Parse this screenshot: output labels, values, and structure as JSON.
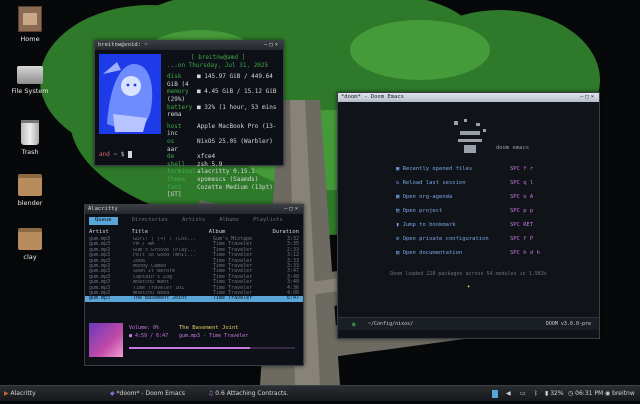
{
  "desktop": {
    "icons": [
      {
        "label": "Home"
      },
      {
        "label": "File System"
      },
      {
        "label": "Trash"
      },
      {
        "label": "blender"
      },
      {
        "label": "clay"
      }
    ]
  },
  "neofetch": {
    "title": "breitnw@void: ~",
    "header_user": "[ breitnw@amd ]",
    "header_date": "...on Thursday, Jul 31, 2025",
    "rows": [
      {
        "key": "disk",
        "value": "■ 145.97 GiB / 449.64 GiB (4"
      },
      {
        "key": "memory",
        "value": "■ 4.45 GiB / 15.12 GiB (29%)"
      },
      {
        "key": "battery",
        "value": "■ 32% (1 hour, 53 mins rema"
      },
      {
        "key": "host",
        "value": "Apple MacBook Pro (13-inc"
      },
      {
        "key": "os",
        "value": "NixOS 25.05 (Warbler) aar"
      },
      {
        "key": "de",
        "value": "xfce4"
      },
      {
        "key": "shell",
        "value": "zsh 5.9"
      },
      {
        "key": "terminal",
        "value": "alacritty 0.15.1"
      },
      {
        "key": "theme",
        "value": "xpomescs (Saamds)"
      },
      {
        "key": "font",
        "value": "Cozette Medium (13pt) [GT]"
      }
    ],
    "prompt_user": "and",
    "prompt_path": "~ $"
  },
  "ncmpcpp": {
    "title": "Alacritty",
    "tabs": [
      "Queue",
      "Directories",
      "Artists",
      "Albums",
      "Playlists"
    ],
    "columns": [
      "Artist",
      "Title",
      "Album",
      "Duration"
    ],
    "rows": [
      {
        "artist": "gum.mp3",
        "title": "Gurl! ( (➜) ) (Cos...",
        "album": "Gum's Mixtape",
        "dur": "3:32"
      },
      {
        "artist": "gum.mp3",
        "title": "FM / AM",
        "album": "Time Traveler",
        "dur": "3:35"
      },
      {
        "artist": "gum.mp3",
        "title": "Gum's Groove (Play...",
        "album": "Time Traveler",
        "dur": "2:33"
      },
      {
        "artist": "gum.mp3",
        "title": "Felt So Good (Whil...",
        "album": "Time Traveler",
        "dur": "3:12"
      },
      {
        "artist": "gum.mp3",
        "title": "2008",
        "album": "Time Traveler",
        "dur": "3:33"
      },
      {
        "artist": "gum.mp3",
        "title": "Moody Cameo",
        "album": "Time Traveler",
        "dur": "3:33"
      },
      {
        "artist": "gum.mp3",
        "title": "Seen It Before",
        "album": "Time Traveler",
        "dur": "3:47"
      },
      {
        "artist": "gum.mp3",
        "title": "Captain's Log",
        "album": "Time Traveler",
        "dur": "3:40"
      },
      {
        "artist": "gum.mp3",
        "title": "Whatchu Want",
        "album": "Time Traveler",
        "dur": "3:40"
      },
      {
        "artist": "gum.mp3",
        "title": "Time Traveler 101",
        "album": "Time Traveler",
        "dur": "4:36"
      },
      {
        "artist": "gum.mp3",
        "title": "Whatchu Need",
        "album": "Time Traveler",
        "dur": "4:06"
      },
      {
        "artist": "gum.mp3",
        "title": "The Basement Joint",
        "album": "Time Traveler",
        "dur": "6:47",
        "selected": true
      }
    ],
    "now_playing": {
      "volume": "Volume: 0%",
      "title": "The Basement Joint",
      "time": "■ 4:59 / 6:47",
      "artist_line": "gum.mp3 - Time Traveler",
      "progress": 0.73
    }
  },
  "emacs": {
    "title": "*doom* - Doom Emacs",
    "logo_text": "doom emacs",
    "menu": [
      {
        "label": "Recently opened files",
        "key": "SPC f r"
      },
      {
        "label": "Reload last session",
        "key": "SPC q l"
      },
      {
        "label": "Open org-agenda",
        "key": "SPC o A"
      },
      {
        "label": "Open project",
        "key": "SPC p p"
      },
      {
        "label": "Jump to bookmark",
        "key": "SPC RET"
      },
      {
        "label": "Open private configuration",
        "key": "SPC f P"
      },
      {
        "label": "Open documentation",
        "key": "SPC h d h"
      }
    ],
    "loaded": "Doom loaded 228 packages across 54 modules in 1.983s",
    "modeline_path": "~/Config/nixos/",
    "modeline_version": "DOOM v3.0.0-pre"
  },
  "taskbar": {
    "items": [
      {
        "label": "Alacritty"
      },
      {
        "label": "*doom* - Doom Emacs"
      },
      {
        "label": "0.6 Attaching Contracts."
      }
    ],
    "battery": "32%",
    "clock": "06:31 PM",
    "user": "breitnw"
  },
  "colors": {
    "accent": "#5aa5d8",
    "green": "#3fa94a",
    "emacs_blue": "#7aa6e8",
    "emacs_purple": "#c878e0"
  }
}
